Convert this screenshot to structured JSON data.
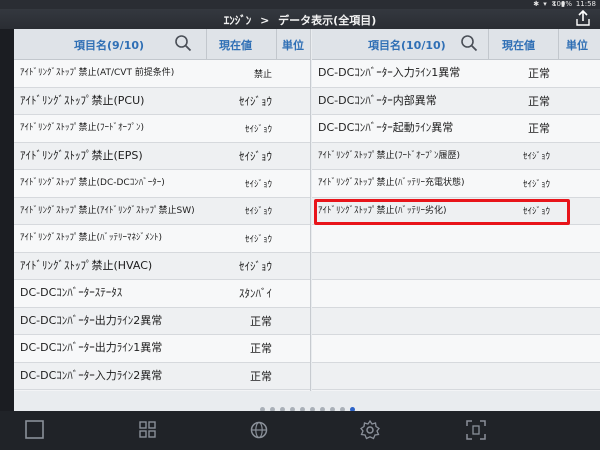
{
  "status_bar": {
    "battery": "100%",
    "time": "11:58"
  },
  "header": {
    "crumbs": [
      "ｴﾝｼﾞﾝ",
      "データ表示(全項目)"
    ],
    "separator": ">",
    "export_icon": "export-icon"
  },
  "left_table": {
    "header": {
      "name": "項目名(9/10)",
      "value": "現在値",
      "unit": "単位"
    },
    "rows": [
      {
        "name": "ｱｲﾄﾞﾘﾝｸﾞｽﾄｯﾌﾟ禁止(AT/CVT 前提条件)",
        "value": "禁止"
      },
      {
        "name": "ｱｲﾄﾞﾘﾝｸﾞｽﾄｯﾌﾟ禁止(PCU)",
        "value": "ｾｲｼﾞｮｳ"
      },
      {
        "name": "ｱｲﾄﾞﾘﾝｸﾞｽﾄｯﾌﾟ禁止(ﾌｰﾄﾞｵｰﾌﾟﾝ)",
        "value": "ｾｲｼﾞｮｳ"
      },
      {
        "name": "ｱｲﾄﾞﾘﾝｸﾞｽﾄｯﾌﾟ禁止(EPS)",
        "value": "ｾｲｼﾞｮｳ"
      },
      {
        "name": "ｱｲﾄﾞﾘﾝｸﾞｽﾄｯﾌﾟ禁止(DC-DCｺﾝﾊﾞｰﾀｰ)",
        "value": "ｾｲｼﾞｮｳ"
      },
      {
        "name": "ｱｲﾄﾞﾘﾝｸﾞｽﾄｯﾌﾟ禁止(ｱｲﾄﾞﾘﾝｸﾞｽﾄｯﾌﾟ禁止SW)",
        "value": "ｾｲｼﾞｮｳ"
      },
      {
        "name": "ｱｲﾄﾞﾘﾝｸﾞｽﾄｯﾌﾟ禁止(ﾊﾞｯﾃﾘｰﾏﾈｼﾞﾒﾝﾄ)",
        "value": "ｾｲｼﾞｮｳ"
      },
      {
        "name": "ｱｲﾄﾞﾘﾝｸﾞｽﾄｯﾌﾟ禁止(HVAC)",
        "value": "ｾｲｼﾞｮｳ"
      },
      {
        "name": "DC-DCｺﾝﾊﾞｰﾀｰｽﾃｰﾀｽ",
        "value": "ｽﾀﾝﾊﾞｲ"
      },
      {
        "name": "DC-DCｺﾝﾊﾞｰﾀｰ出力ﾗｲﾝ2異常",
        "value": "正常"
      },
      {
        "name": "DC-DCｺﾝﾊﾞｰﾀｰ出力ﾗｲﾝ1異常",
        "value": "正常"
      },
      {
        "name": "DC-DCｺﾝﾊﾞｰﾀｰ入力ﾗｲﾝ2異常",
        "value": "正常"
      }
    ]
  },
  "right_table": {
    "header": {
      "name": "項目名(10/10)",
      "value": "現在値",
      "unit": "単位"
    },
    "rows": [
      {
        "name": "DC-DCｺﾝﾊﾞｰﾀｰ入力ﾗｲﾝ1異常",
        "value": "正常"
      },
      {
        "name": "DC-DCｺﾝﾊﾞｰﾀｰ内部異常",
        "value": "正常"
      },
      {
        "name": "DC-DCｺﾝﾊﾞｰﾀｰ起動ﾗｲﾝ異常",
        "value": "正常"
      },
      {
        "name": "ｱｲﾄﾞﾘﾝｸﾞｽﾄｯﾌﾟ禁止(ﾌｰﾄﾞｵｰﾌﾟﾝ履歴)",
        "value": "ｾｲｼﾞｮｳ"
      },
      {
        "name": "ｱｲﾄﾞﾘﾝｸﾞｽﾄｯﾌﾟ禁止(ﾊﾞｯﾃﾘｰ充電状態)",
        "value": "ｾｲｼﾞｮｳ"
      },
      {
        "name": "ｱｲﾄﾞﾘﾝｸﾞｽﾄｯﾌﾟ禁止(ﾊﾞｯﾃﾘｰ劣化)",
        "value": "ｾｲｼﾞｮｳ",
        "highlighted": true
      },
      {
        "name": "",
        "value": ""
      },
      {
        "name": "",
        "value": ""
      },
      {
        "name": "",
        "value": ""
      },
      {
        "name": "",
        "value": ""
      },
      {
        "name": "",
        "value": ""
      },
      {
        "name": "",
        "value": ""
      }
    ]
  },
  "pager": {
    "total_pages": 10,
    "current_page": 10
  },
  "highlight_color": "#e8141a",
  "accent_color": "#2f6fb5",
  "bottom_nav": [
    "window-icon",
    "grid-icon",
    "globe-icon",
    "settings-icon",
    "scan-icon"
  ]
}
